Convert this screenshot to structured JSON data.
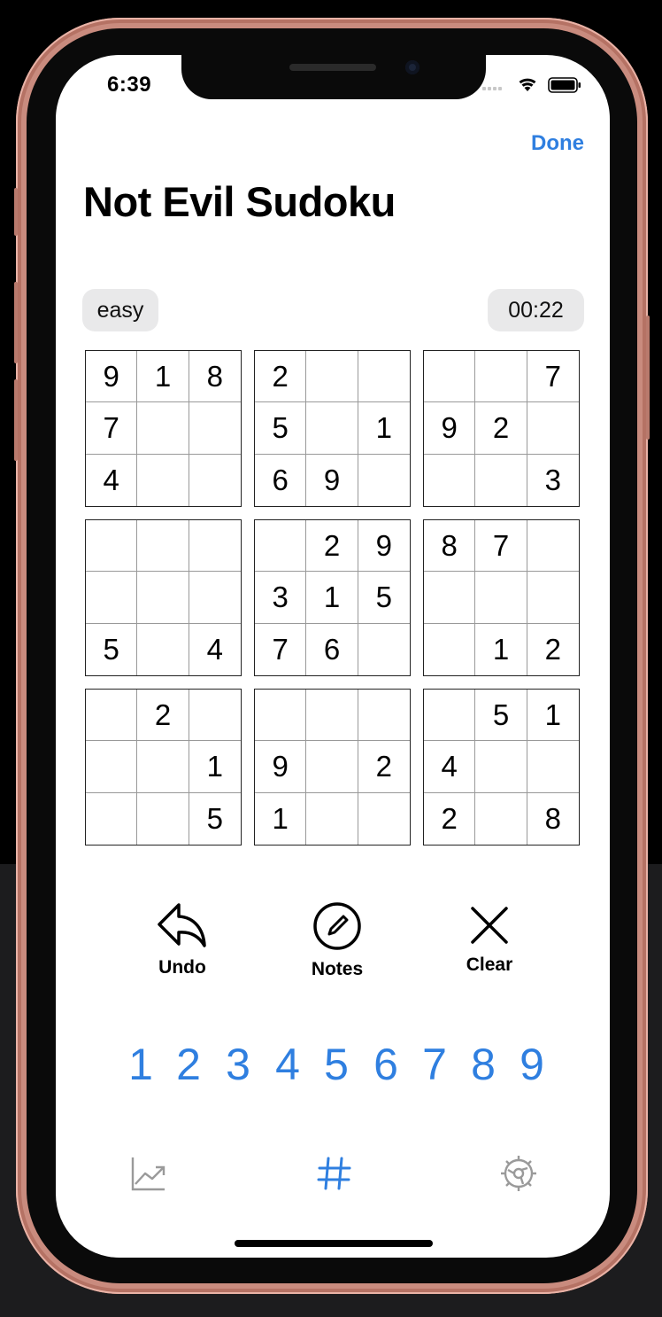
{
  "status_bar": {
    "time": "6:39"
  },
  "header": {
    "done_label": "Done",
    "title": "Not Evil Sudoku"
  },
  "game": {
    "difficulty": "easy",
    "timer": "00:22"
  },
  "board": [
    [
      "9",
      "1",
      "8",
      "2",
      "",
      "",
      "",
      "",
      "7"
    ],
    [
      "7",
      "",
      "",
      "5",
      "",
      "1",
      "9",
      "2",
      ""
    ],
    [
      "4",
      "",
      "",
      "6",
      "9",
      "",
      "",
      "",
      "3"
    ],
    [
      "",
      "",
      "",
      "",
      "2",
      "9",
      "8",
      "7",
      ""
    ],
    [
      "",
      "",
      "",
      "3",
      "1",
      "5",
      "",
      "",
      ""
    ],
    [
      "5",
      "",
      "4",
      "7",
      "6",
      "",
      "",
      "1",
      "2"
    ],
    [
      "",
      "2",
      "",
      "",
      "",
      "",
      "",
      "5",
      "1"
    ],
    [
      "",
      "",
      "1",
      "9",
      "",
      "2",
      "4",
      "",
      ""
    ],
    [
      "",
      "",
      "5",
      "1",
      "",
      "",
      "2",
      "",
      "8"
    ]
  ],
  "actions": {
    "undo_label": "Undo",
    "notes_label": "Notes",
    "clear_label": "Clear"
  },
  "numpad": [
    "1",
    "2",
    "3",
    "4",
    "5",
    "6",
    "7",
    "8",
    "9"
  ],
  "tabs": [
    {
      "icon": "stats-chart-icon",
      "active": false
    },
    {
      "icon": "hash-grid-icon",
      "active": true
    },
    {
      "icon": "gear-icon",
      "active": false
    }
  ],
  "colors": {
    "accent": "#2f7fe0",
    "inactive_tab": "#9a9a9a",
    "pill_bg": "#e9e9ea"
  }
}
